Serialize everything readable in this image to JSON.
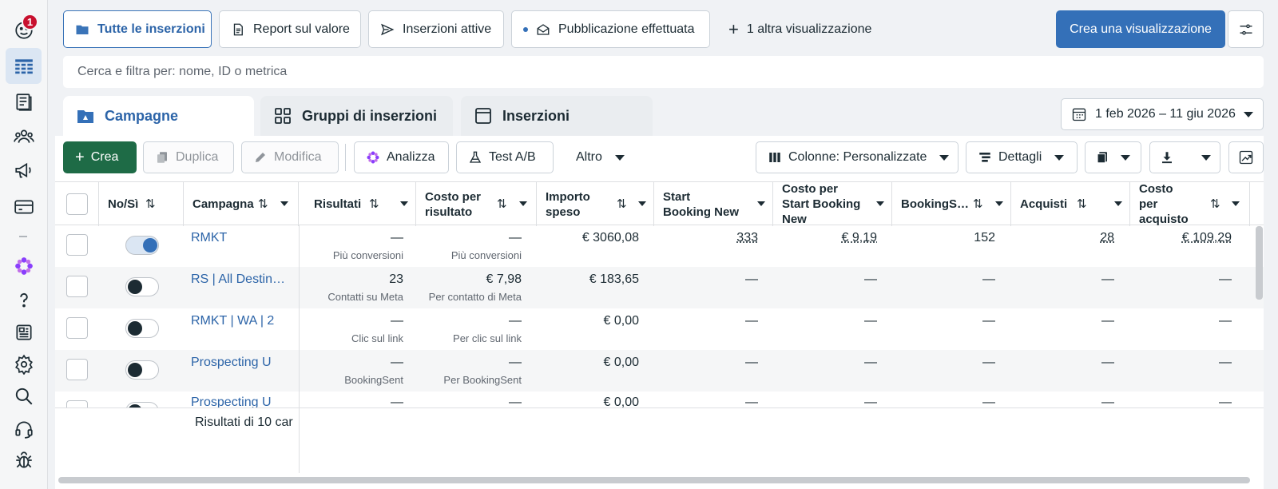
{
  "rail": {
    "badge_count": "1"
  },
  "views": {
    "all_ads": "Tutte le inserzioni",
    "value_report": "Report sul valore",
    "active_ads": "Inserzioni attive",
    "published": "Pubblicazione effettuata",
    "more_views": "1 altra visualizzazione",
    "create_view": "Crea una visualizzazione"
  },
  "search": {
    "placeholder": "Cerca e filtra per: nome, ID o metrica"
  },
  "levels": {
    "campaigns": "Campagne",
    "adsets": "Gruppi di inserzioni",
    "ads": "Inserzioni"
  },
  "date_range": "1 feb 2026 – 11 giu 2026",
  "toolbar": {
    "create": "Crea",
    "duplicate": "Duplica",
    "edit": "Modifica",
    "analyze": "Analizza",
    "ab_test": "Test A/B",
    "more": "Altro",
    "columns": "Colonne: Personalizzate",
    "details": "Dettagli"
  },
  "columns": [
    {
      "key": "toggle",
      "label": "No/Sì"
    },
    {
      "key": "campaign",
      "label": "Campagna"
    },
    {
      "key": "results",
      "label": "Risultati"
    },
    {
      "key": "cpr",
      "label": "Costo per risultato"
    },
    {
      "key": "spend",
      "label": "Importo speso"
    },
    {
      "key": "start_booking",
      "label": "Start Booking New"
    },
    {
      "key": "cost_start_booking",
      "label": "Costo per Start Booking New"
    },
    {
      "key": "booking_sent",
      "label": "BookingS…"
    },
    {
      "key": "purchases",
      "label": "Acquisti"
    },
    {
      "key": "cost_purchase",
      "label": "Costo per acquisto"
    }
  ],
  "rows": [
    {
      "on": true,
      "name": "RMKT",
      "results": "—",
      "results_sub": "Più conversioni",
      "cpr": "—",
      "cpr_sub": "Più conversioni",
      "spend": "€ 3060,08",
      "start_booking": "333",
      "cost_start_booking": "€ 9,19",
      "booking_sent": "152",
      "purchases": "28",
      "cost_purchase": "€ 109,29"
    },
    {
      "on": false,
      "name": "RS | All Destinations",
      "results": "23",
      "results_sub": "Contatti su Meta",
      "cpr": "€ 7,98",
      "cpr_sub": "Per contatto di Meta",
      "spend": "€ 183,65",
      "start_booking": "—",
      "cost_start_booking": "—",
      "booking_sent": "—",
      "purchases": "—",
      "cost_purchase": "—"
    },
    {
      "on": false,
      "name": "RMKT | WA | 2",
      "results": "—",
      "results_sub": "Clic sul link",
      "cpr": "—",
      "cpr_sub": "Per clic sul link",
      "spend": "€ 0,00",
      "start_booking": "—",
      "cost_start_booking": "—",
      "booking_sent": "—",
      "purchases": "—",
      "cost_purchase": "—"
    },
    {
      "on": false,
      "name": "Prospecting U",
      "results": "—",
      "results_sub": "BookingSent",
      "cpr": "—",
      "cpr_sub": "Per BookingSent",
      "spend": "€ 0,00",
      "start_booking": "—",
      "cost_start_booking": "—",
      "booking_sent": "—",
      "purchases": "—",
      "cost_purchase": "—"
    },
    {
      "on": false,
      "name": "Prospecting U",
      "results": "—",
      "results_sub": "",
      "cpr": "—",
      "cpr_sub": "",
      "spend": "€ 0,00",
      "start_booking": "—",
      "cost_start_booking": "—",
      "booking_sent": "—",
      "purchases": "—",
      "cost_purchase": "—"
    }
  ],
  "footer": {
    "results_label": "Risultati di 10 car"
  }
}
